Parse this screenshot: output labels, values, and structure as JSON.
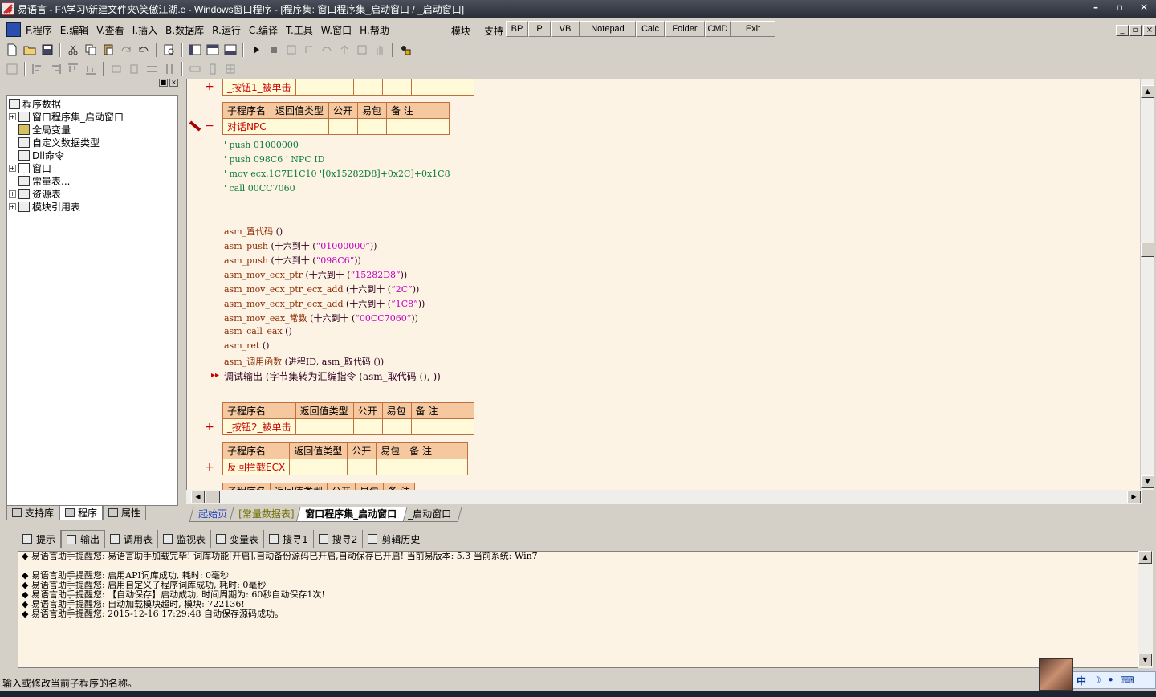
{
  "window": {
    "title": "易语言 - F:\\学习\\新建文件夹\\笑傲江湖.e - Windows窗口程序 - [程序集: 窗口程序集_启动窗口 / _启动窗口]"
  },
  "menu": [
    "F.程序",
    "E.编辑",
    "V.查看",
    "I.插入",
    "B.数据库",
    "R.运行",
    "C.编译",
    "T.工具",
    "W.窗口",
    "H.帮助"
  ],
  "quickbar": {
    "module_label": "模块",
    "support_label": "支持",
    "buttons": [
      "BP",
      "P",
      "VB",
      "Notepad",
      "Calc",
      "Folder",
      "CMD",
      "Exit"
    ]
  },
  "tree": {
    "root": "程序数据",
    "items": [
      "窗口程序集_启动窗口",
      "全局变量",
      "自定义数据类型",
      "Dll命令",
      "窗口",
      "常量表...",
      "资源表",
      "模块引用表"
    ]
  },
  "left_tabs": [
    "支持库",
    "程序",
    "属性"
  ],
  "editor": {
    "headers": [
      "子程序名",
      "返回值类型",
      "公开",
      "易包",
      "备 注"
    ],
    "subs": [
      "_按钮1_被单击",
      "对话NPC",
      "_按钮2_被单击",
      "反回拦截ECX"
    ],
    "comments": [
      "' push 01000000",
      "' push 098C6    ' NPC ID",
      "' mov ecx,1C7E1C10   '[0x15282D8]+0x2C]+0x1C8",
      "' call 00CC7060"
    ],
    "code_lines": [
      {
        "f": "asm_置代码",
        "p": " ()",
        "s": "",
        "e": ""
      },
      {
        "f": "asm_push",
        "p": " (十六到十 (",
        "s": "“01000000”",
        "e": "))"
      },
      {
        "f": "asm_push",
        "p": " (十六到十 (",
        "s": "“098C6”",
        "e": "))"
      },
      {
        "f": "asm_mov_ecx_ptr",
        "p": " (十六到十 (",
        "s": "“15282D8”",
        "e": "))"
      },
      {
        "f": "asm_mov_ecx_ptr_ecx_add",
        "p": " (十六到十 (",
        "s": "“2C”",
        "e": "))"
      },
      {
        "f": "asm_mov_ecx_ptr_ecx_add",
        "p": " (十六到十 (",
        "s": "“1C8”",
        "e": "))"
      },
      {
        "f": "asm_mov_eax_常数",
        "p": " (十六到十 (",
        "s": "“00CC7060”",
        "e": "))"
      },
      {
        "f": "asm_call_eax",
        "p": " ()",
        "s": "",
        "e": ""
      },
      {
        "f": "asm_ret",
        "p": " ()",
        "s": "",
        "e": ""
      },
      {
        "f": "asm_调用函数",
        "p": " (进程ID, asm_取代码 ())",
        "s": "",
        "e": ""
      }
    ],
    "debug_line": "调试输出 (字节集转为汇编指令 (asm_取代码 (), ))"
  },
  "editor_tabs": [
    "起始页",
    "[常量数据表]",
    "窗口程序集_启动窗口",
    "_启动窗口"
  ],
  "output_tabs": [
    "提示",
    "输出",
    "调用表",
    "监视表",
    "变量表",
    "搜寻1",
    "搜寻2",
    "剪辑历史"
  ],
  "output_lines": [
    "◆ 易语言助手提醒您:  易语言助手加载完毕!  词库功能[开启],自动备份源码已开启,自动保存已开启!  当前易版本: 5.3  当前系统: Win7",
    "",
    "◆ 易语言助手提醒您: 启用API词库成功, 耗时: 0毫秒",
    "◆ 易语言助手提醒您: 启用自定义子程序词库成功, 耗时: 0毫秒",
    "◆ 易语言助手提醒您: 【自动保存】启动成功, 时间周期为: 60秒自动保存1次!",
    "◆ 易语言助手提醒您: 自动加载模块超时, 模块: 722136!",
    "◆ 易语言助手提醒您: 2015-12-16 17:29:48 自动保存源码成功。"
  ],
  "status": "输入或修改当前子程序的名称。",
  "ime": {
    "lang": "中"
  },
  "colors": {
    "editor_bg": "#fdf3e5",
    "grid_header": "#f5c8a0",
    "grid_value": "#fffbd8",
    "func": "#8a2a00",
    "string": "#c000c0",
    "comment": "#0a7a3a"
  }
}
